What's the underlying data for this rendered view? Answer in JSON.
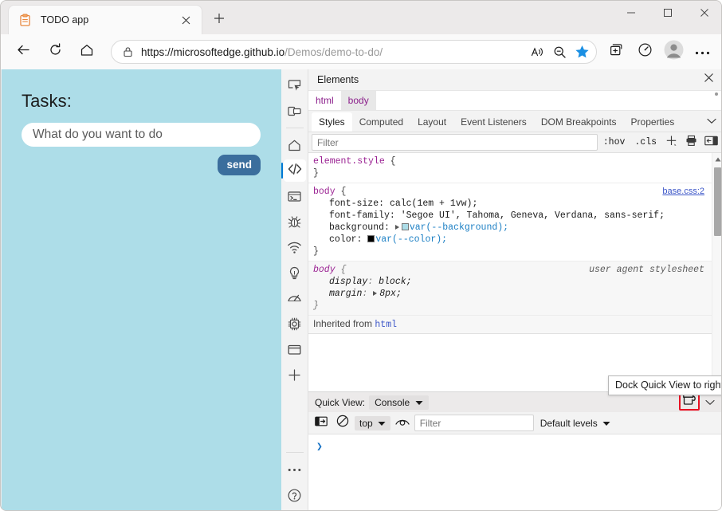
{
  "browser": {
    "tab": {
      "title": "TODO app",
      "favicon_icon": "clipboard-icon",
      "close_icon": "close-icon"
    },
    "new_tab_icon": "plus-icon",
    "window_controls": {
      "minimize": "minimize-icon",
      "maximize": "maximize-icon",
      "close": "close-icon"
    },
    "nav": {
      "back_icon": "back-arrow-icon",
      "refresh_icon": "refresh-icon",
      "home_icon": "home-icon"
    },
    "omnibox": {
      "lock_icon": "lock-icon",
      "url_domain": "https://microsoftedge.github.io",
      "url_path": "/Demos/demo-to-do/",
      "read_aloud_icon": "read-aloud-icon",
      "zoom_out_icon": "zoom-out-icon",
      "favorite_icon": "star-filled-icon",
      "favorite_color": "#1a8fe3"
    },
    "toolbar": {
      "collections_icon": "collections-icon",
      "performance_icon": "performance-gauge-icon",
      "profile_icon": "profile-avatar-icon",
      "settings_icon": "more-ellipsis-icon"
    }
  },
  "page": {
    "background_color": "#addde8",
    "heading": "Tasks:",
    "input_placeholder": "What do you want to do",
    "send_label": "send",
    "send_color": "#3b6e9d"
  },
  "devtools": {
    "rail": [
      {
        "name": "inspect-element-icon",
        "label": "Inspect"
      },
      {
        "name": "device-emulation-icon",
        "label": "Device Emulation"
      },
      {
        "name": "home-icon",
        "label": "Welcome"
      },
      {
        "name": "elements-code-icon",
        "label": "Elements",
        "selected": true
      },
      {
        "name": "console-terminal-icon",
        "label": "Console"
      },
      {
        "name": "debugger-bug-icon",
        "label": "Sources"
      },
      {
        "name": "network-wifi-icon",
        "label": "Network"
      },
      {
        "name": "issues-lightbulb-icon",
        "label": "Issues"
      },
      {
        "name": "performance-gauge-icon",
        "label": "Performance"
      },
      {
        "name": "memory-chip-icon",
        "label": "Memory"
      },
      {
        "name": "application-window-icon",
        "label": "Application"
      },
      {
        "name": "add-tool-plus-icon",
        "label": "More tools"
      }
    ],
    "rail_bottom": [
      {
        "name": "more-ellipsis-icon",
        "label": "More"
      },
      {
        "name": "help-question-icon",
        "label": "Help"
      }
    ],
    "header": {
      "title": "Elements",
      "close_icon": "close-icon"
    },
    "breadcrumb": [
      {
        "label": "html",
        "selected": false
      },
      {
        "label": "body",
        "selected": true
      }
    ],
    "style_tabs": [
      {
        "label": "Styles",
        "selected": true
      },
      {
        "label": "Computed",
        "selected": false
      },
      {
        "label": "Layout",
        "selected": false
      },
      {
        "label": "Event Listeners",
        "selected": false
      },
      {
        "label": "DOM Breakpoints",
        "selected": false
      },
      {
        "label": "Properties",
        "selected": false
      }
    ],
    "style_tabs_overflow_icon": "chevron-down-icon",
    "filter": {
      "placeholder": "Filter",
      "hov_label": ":hov",
      "cls_label": ".cls",
      "new_rule_icon": "plus-icon",
      "print_icon": "print-media-icon",
      "sidebar_icon": "toggle-sidebar-icon"
    },
    "rules": [
      {
        "selector": "element.style",
        "source": "",
        "user_agent": false,
        "declarations": []
      },
      {
        "selector": "body",
        "source": "base.css:2",
        "user_agent": false,
        "declarations": [
          {
            "prop": "font-size",
            "value": "calc(1em + 1vw);",
            "expand": false,
            "swatch": null
          },
          {
            "prop": "font-family",
            "value": "'Segoe UI', Tahoma, Geneva, Verdana, sans-serif;",
            "expand": false,
            "swatch": null
          },
          {
            "prop": "background",
            "value": "var(--background);",
            "expand": true,
            "swatch": "#addde8"
          },
          {
            "prop": "color",
            "value": "var(--color);",
            "expand": false,
            "swatch": "#000000"
          }
        ]
      },
      {
        "selector": "body",
        "source": "user agent stylesheet",
        "user_agent": true,
        "declarations": [
          {
            "prop": "display",
            "value": "block;",
            "expand": false,
            "swatch": null
          },
          {
            "prop": "margin",
            "value": "8px;",
            "expand": true,
            "swatch": null
          }
        ]
      }
    ],
    "inherited_label": "Inherited from",
    "inherited_node": "html",
    "scrollbar": {
      "up_icon": "scroll-up-arrow-icon",
      "down_icon": "scroll-down-arrow-icon"
    }
  },
  "quickview": {
    "label": "Quick View:",
    "selected_tool": "Console",
    "dropdown_icon": "chevron-down-filled-icon",
    "dock_icon": "dock-quick-view-right-icon",
    "dock_highlight_color": "#e81123",
    "collapse_icon": "chevron-down-icon",
    "tooltip": "Dock Quick View to right"
  },
  "console": {
    "sidebar_icon": "console-sidebar-icon",
    "clear_icon": "clear-console-icon",
    "context": "top",
    "context_dropdown_icon": "chevron-down-filled-icon",
    "live_expression_icon": "eye-icon",
    "filter_placeholder": "Filter",
    "levels_label": "Default levels",
    "levels_dropdown_icon": "chevron-down-filled-icon",
    "prompt": "❯"
  }
}
